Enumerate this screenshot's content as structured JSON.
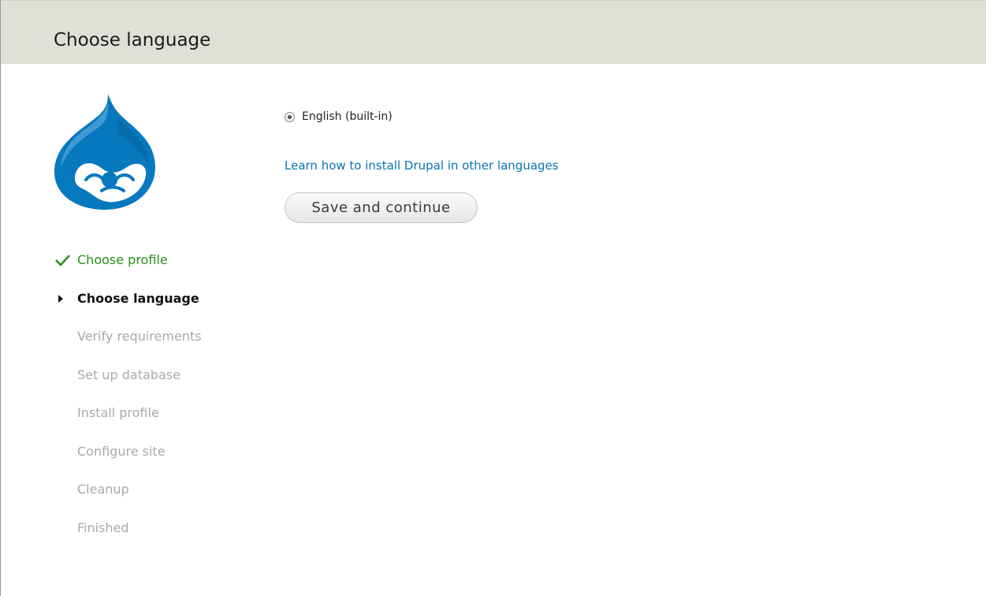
{
  "header": {
    "title": "Choose language"
  },
  "logo": {
    "icon": "drupal-drop-logo",
    "color": "#0678be"
  },
  "steps": [
    {
      "label": "Choose profile",
      "status": "done",
      "icon": "checkmark-icon"
    },
    {
      "label": "Choose language",
      "status": "active",
      "icon": "triangle-right-icon"
    },
    {
      "label": "Verify requirements",
      "status": "pending"
    },
    {
      "label": "Set up database",
      "status": "pending"
    },
    {
      "label": "Install profile",
      "status": "pending"
    },
    {
      "label": "Configure site",
      "status": "pending"
    },
    {
      "label": "Cleanup",
      "status": "pending"
    },
    {
      "label": "Finished",
      "status": "pending"
    }
  ],
  "form": {
    "language_option": "English (built-in)",
    "language_selected": true,
    "learn_link": "Learn how to install Drupal in other languages",
    "submit_label": "Save and continue"
  },
  "colors": {
    "header_bg": "#e0e0d8",
    "done": "#2a8c1a",
    "pending": "#a9a9a9",
    "link": "#0674b3"
  }
}
